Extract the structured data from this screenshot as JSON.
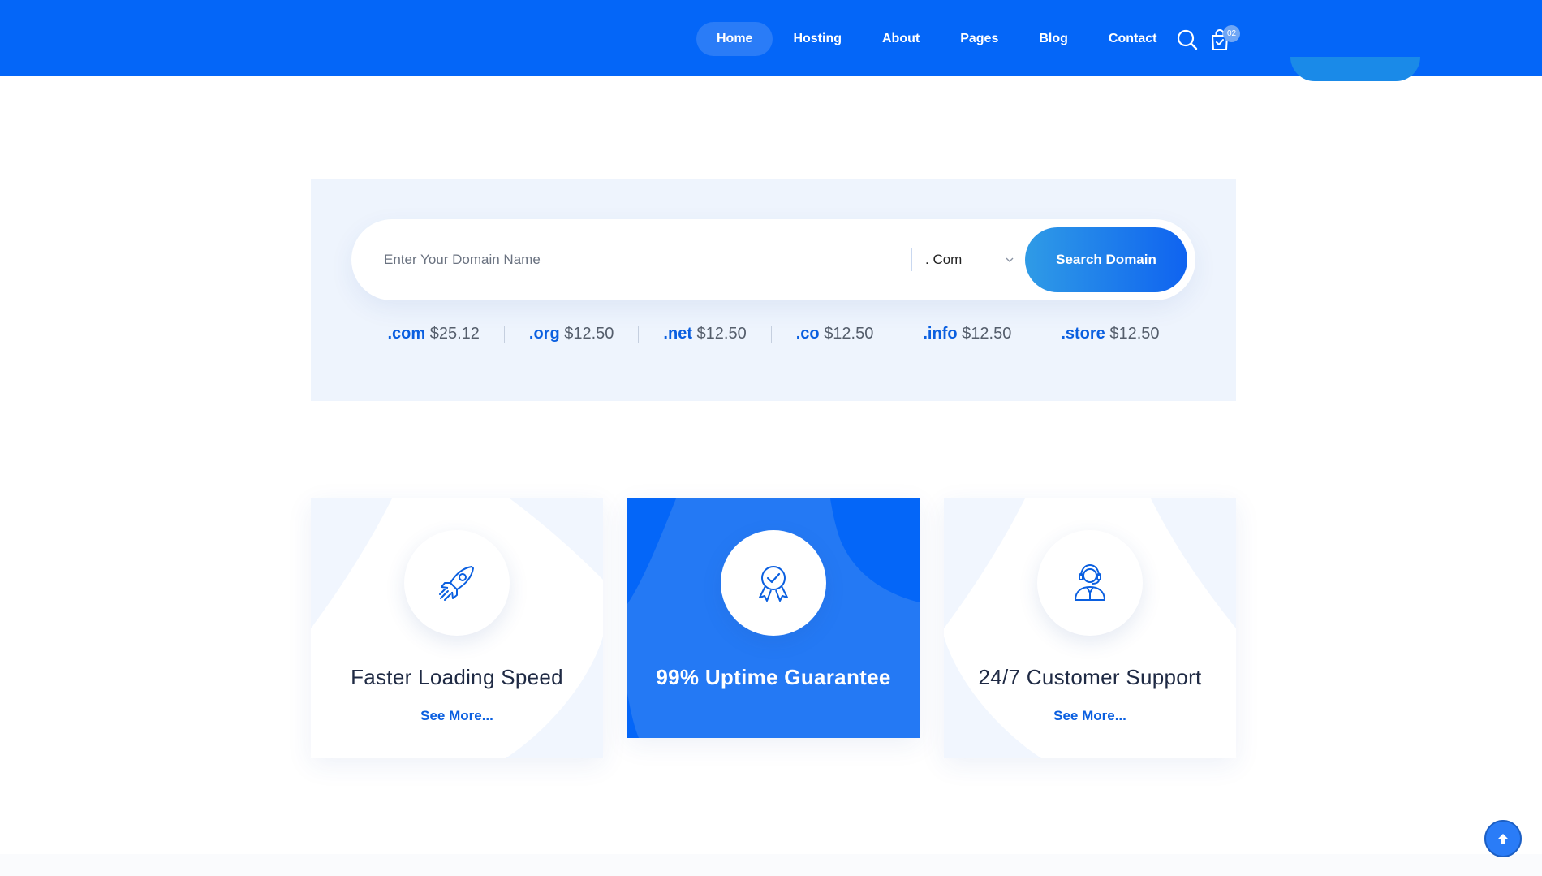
{
  "nav": {
    "items": [
      {
        "label": "Home",
        "active": true
      },
      {
        "label": "Hosting",
        "active": false
      },
      {
        "label": "About",
        "active": false
      },
      {
        "label": "Pages",
        "active": false
      },
      {
        "label": "Blog",
        "active": false
      },
      {
        "label": "Contact",
        "active": false
      }
    ],
    "search_icon": "search-icon",
    "cart_icon": "shopping-bag-icon",
    "cart_count": "02"
  },
  "domain_search": {
    "placeholder": "Enter Your Domain Name",
    "value": "",
    "tld_selected": ". Com",
    "button_label": "Search Domain",
    "prices": [
      {
        "ext": ".com",
        "price": "$25.12"
      },
      {
        "ext": ".org",
        "price": "$12.50"
      },
      {
        "ext": ".net",
        "price": "$12.50"
      },
      {
        "ext": ".co",
        "price": "$12.50"
      },
      {
        "ext": ".info",
        "price": "$12.50"
      },
      {
        "ext": ".store",
        "price": "$12.50"
      }
    ]
  },
  "features": [
    {
      "icon": "rocket-icon",
      "title": "Faster Loading Speed",
      "link": "See More..."
    },
    {
      "icon": "award-badge-icon",
      "title": "99% Uptime Guarantee",
      "link": ""
    },
    {
      "icon": "support-agent-icon",
      "title": "24/7 Customer Support",
      "link": "See More..."
    }
  ],
  "back_to_top_icon": "arrow-up-icon",
  "colors": {
    "primary": "#0466f8",
    "accent_blue": "#0a5fe0",
    "domain_bg": "#eef4fd",
    "highlight_card": "#2479f4",
    "heading": "#1f2a44"
  }
}
